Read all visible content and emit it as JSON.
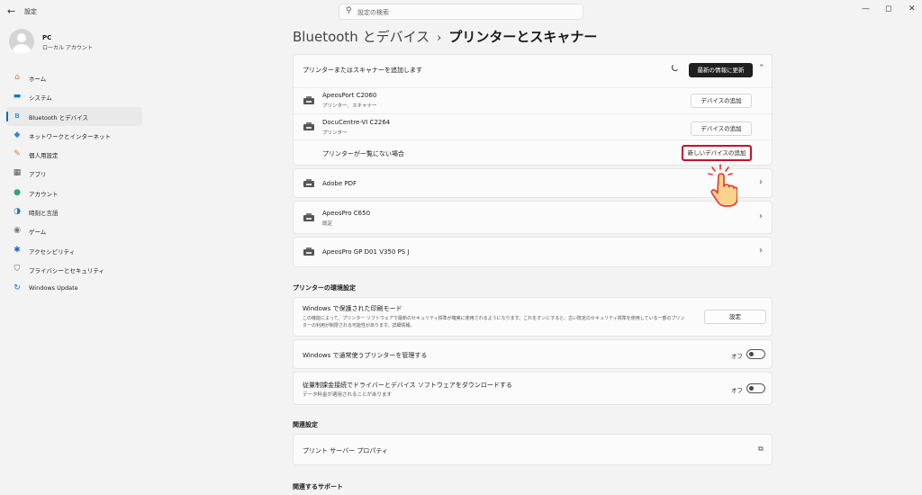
{
  "window": {
    "title": "設定",
    "back_icon": "arrow-left-icon",
    "minimize_glyph": "—",
    "maximize_glyph": "◻",
    "close_glyph": "✕"
  },
  "search": {
    "placeholder": "設定の検索",
    "icon": "search-icon"
  },
  "profile": {
    "name": "PC",
    "account": "ローカル アカウント"
  },
  "sidebar": {
    "items": [
      {
        "label": "ホーム",
        "icon": "home-icon",
        "glyph": "⌂",
        "color": "#c97b2c"
      },
      {
        "label": "システム",
        "icon": "display-icon",
        "glyph": "▬",
        "color": "#0078d4"
      },
      {
        "label": "Bluetooth とデバイス",
        "icon": "bluetooth-icon",
        "glyph": "ʙ",
        "color": "#0078d4",
        "active": true
      },
      {
        "label": "ネットワークとインターネット",
        "icon": "wifi-icon",
        "glyph": "◆",
        "color": "#2b88d8"
      },
      {
        "label": "個人用設定",
        "icon": "brush-icon",
        "glyph": "✎",
        "color": "#e07b39"
      },
      {
        "label": "アプリ",
        "icon": "apps-icon",
        "glyph": "▦",
        "color": "#555555"
      },
      {
        "label": "アカウント",
        "icon": "person-icon",
        "glyph": "●",
        "color": "#2aa876"
      },
      {
        "label": "時刻と言語",
        "icon": "globe-clock-icon",
        "glyph": "◑",
        "color": "#1e73be"
      },
      {
        "label": "ゲーム",
        "icon": "gamepad-icon",
        "glyph": "◉",
        "color": "#777777"
      },
      {
        "label": "アクセシビリティ",
        "icon": "accessibility-icon",
        "glyph": "✱",
        "color": "#1a6fc4"
      },
      {
        "label": "プライバシーとセキュリティ",
        "icon": "shield-icon",
        "glyph": "⛉",
        "color": "#6d6d6d"
      },
      {
        "label": "Windows Update",
        "icon": "update-icon",
        "glyph": "↻",
        "color": "#0b74c5"
      }
    ]
  },
  "header": {
    "crumb": "Bluetooth とデバイス",
    "separator": "›",
    "current": "プリンターとスキャナー"
  },
  "add_panel": {
    "title": "プリンターまたはスキャナーを追加します",
    "refresh_label": "最新の情報に更新",
    "collapse_glyph": "⌃",
    "found": [
      {
        "name": "ApeosPort C2060",
        "type": "プリンター、スキャナー",
        "button": "デバイスの追加"
      },
      {
        "name": "DocuCentre-VI C2264",
        "type": "プリンター",
        "button": "デバイスの追加"
      }
    ],
    "not_listed_label": "プリンターが一覧にない場合",
    "add_new_label": "新しいデバイスの追加"
  },
  "installed": [
    {
      "name": "Adobe PDF",
      "status": ""
    },
    {
      "name": "ApeosPro C650",
      "status": "既定"
    },
    {
      "name": "ApeosPro GP D01 V350 PS J",
      "status": ""
    }
  ],
  "chevron_glyph": "›",
  "prefs": {
    "title": "プリンターの環境設定",
    "protected_mode": {
      "label": "Windows で保護された印刷モード",
      "desc1": "この機能によって、プリンター ソフトウェアで最新のセキュリティ標準が確実に使用されるようになります。これをオンにすると、古い既定のセキュリティ標準を使用している一部のプリン",
      "desc2": "ターの利用が制限される可能性があります。",
      "link": "詳細情報。",
      "button": "設定"
    },
    "manage_default": {
      "label": "Windows で通常使うプリンターを管理する",
      "state": "オフ",
      "on": false
    },
    "metered": {
      "label": "従量制課金接続でドライバーとデバイス ソフトウェアをダウンロードする",
      "desc": "データ料金が適用されることがあります",
      "state": "オフ",
      "on": false
    }
  },
  "related": {
    "title": "関連設定",
    "print_server": "プリント サーバー プロパティ",
    "external_icon": "open-external-icon",
    "external_glyph": "⧉"
  },
  "support": {
    "title": "関連するサポート"
  },
  "colors": {
    "accent": "#0067c0",
    "highlight": "#c8102e",
    "dark_button": "#1f1f1f"
  }
}
